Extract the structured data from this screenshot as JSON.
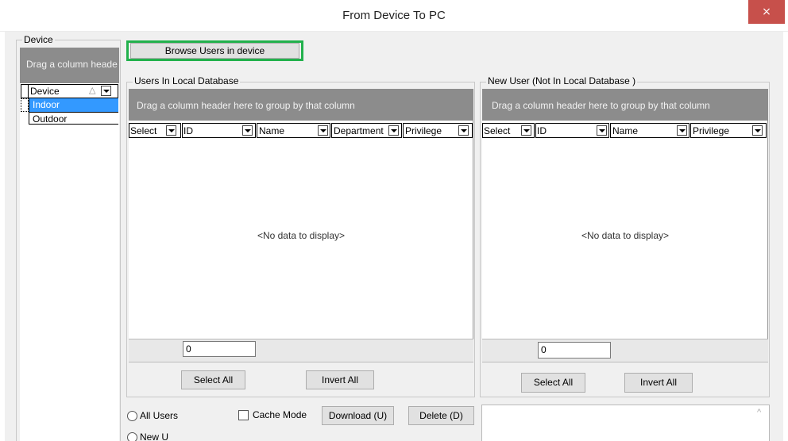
{
  "window": {
    "title": "From Device To PC",
    "close_glyph": "×"
  },
  "device_group": {
    "label": "Device",
    "drag_hint": "Drag a column heade",
    "column_header": "Device",
    "sort_glyph": "△",
    "rows": [
      "Indoor",
      "Outdoor"
    ],
    "selected_row": "Indoor"
  },
  "browse_button": {
    "label": "Browse Users in device",
    "highlight_color": "#22b14c"
  },
  "local_db": {
    "label": "Users In Local Database",
    "drag_hint": "Drag a column header here to group by that column",
    "columns": [
      "Select",
      "ID",
      "Name",
      "Department",
      "Privilege"
    ],
    "empty_text": "<No data to display>",
    "count": "0",
    "select_all": "Select All",
    "invert_all": "Invert All"
  },
  "new_user": {
    "label": "New User (Not In Local Database )",
    "drag_hint": "Drag a column header here to group by that column",
    "columns": [
      "Select",
      "ID",
      "Name",
      "Privilege"
    ],
    "empty_text": "<No data to display>",
    "count": "0",
    "select_all": "Select All",
    "invert_all": "Invert All"
  },
  "bottom": {
    "radio_all_users": "All Users",
    "radio_new_users": "New U",
    "cache_mode": "Cache Mode",
    "download": "Download (U)",
    "delete": "Delete (D)",
    "scroll_up_glyph": "^"
  },
  "colors": {
    "selection": "#3399ff",
    "drag_area": "#8c8c8c",
    "close_button": "#c7504b"
  }
}
